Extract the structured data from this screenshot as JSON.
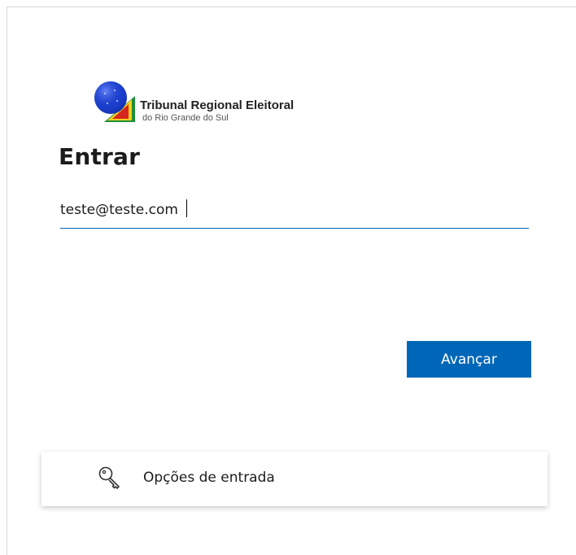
{
  "logo": {
    "title": "Tribunal Regional Eleitoral",
    "subtitle": "do Rio Grande do Sul"
  },
  "login": {
    "heading": "Entrar",
    "email_value": "teste@teste.com",
    "next_label": "Avançar"
  },
  "signin_options": {
    "label": "Opções de entrada",
    "icon": "key-icon"
  },
  "colors": {
    "accent": "#0067b8",
    "text": "#1b1b1b"
  }
}
